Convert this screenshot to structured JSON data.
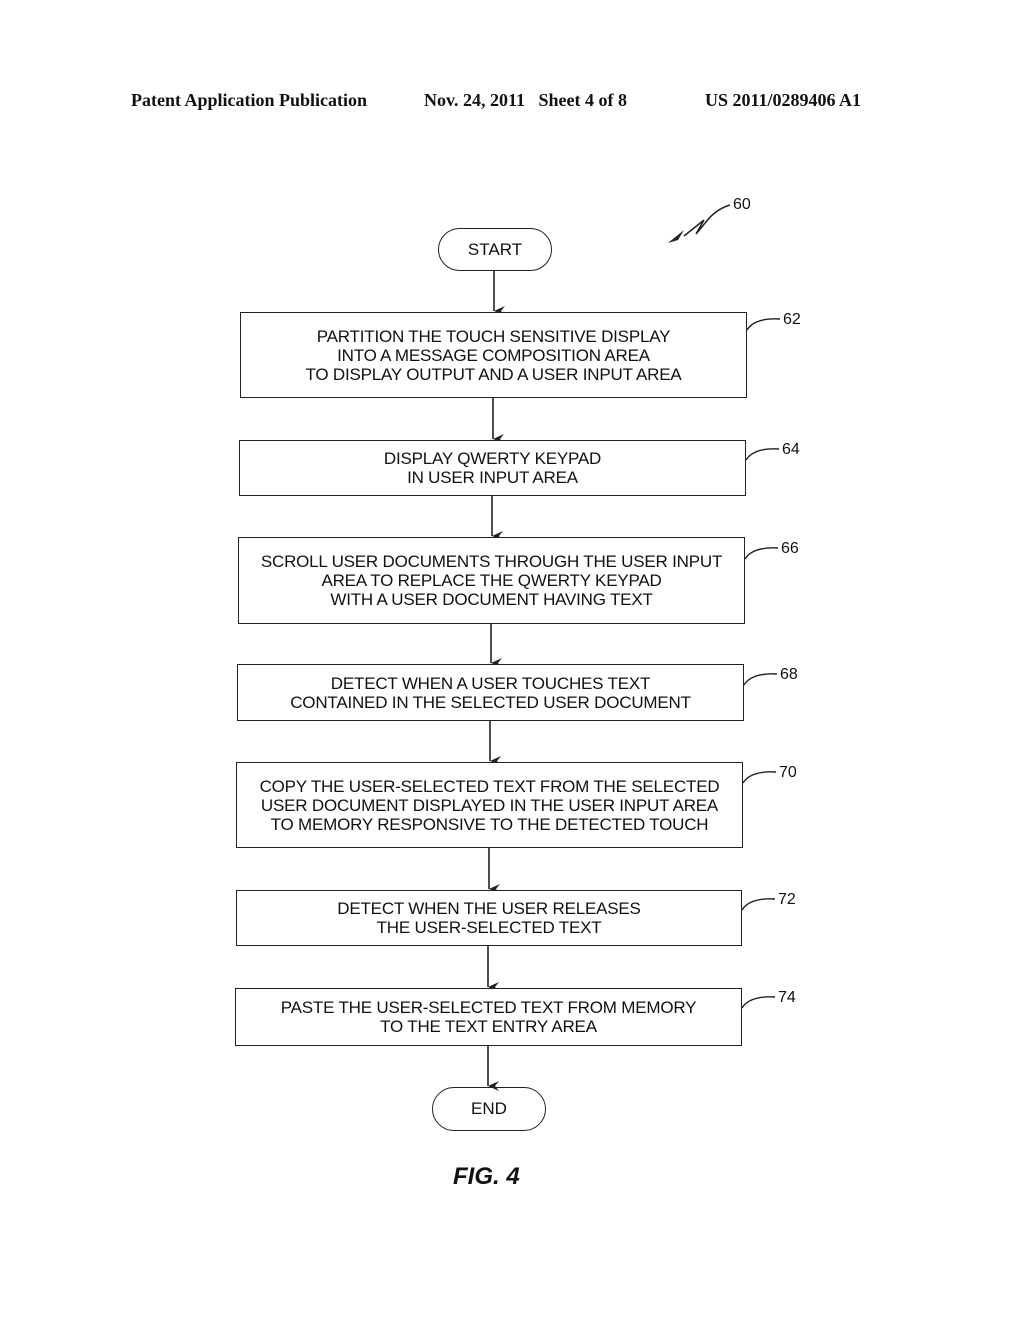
{
  "header": {
    "publication": "Patent Application Publication",
    "date_sheet": "Nov. 24, 2011   Sheet 4 of 8",
    "number": "US 2011/0289406 A1"
  },
  "diagram": {
    "ref_main": "60",
    "start_label": "START",
    "end_label": "END",
    "steps": [
      {
        "ref": "62",
        "lines": [
          "PARTITION THE TOUCH SENSITIVE DISPLAY",
          "INTO A MESSAGE COMPOSITION AREA",
          "TO DISPLAY OUTPUT AND A USER INPUT AREA"
        ]
      },
      {
        "ref": "64",
        "lines": [
          "DISPLAY QWERTY KEYPAD",
          "IN USER INPUT AREA"
        ]
      },
      {
        "ref": "66",
        "lines": [
          "SCROLL USER DOCUMENTS THROUGH THE USER INPUT",
          "AREA TO REPLACE THE QWERTY KEYPAD",
          "WITH A USER DOCUMENT HAVING TEXT"
        ]
      },
      {
        "ref": "68",
        "lines": [
          "DETECT WHEN A USER TOUCHES TEXT",
          "CONTAINED IN THE SELECTED USER DOCUMENT"
        ]
      },
      {
        "ref": "70",
        "lines": [
          "COPY THE USER-SELECTED TEXT FROM THE SELECTED",
          "USER DOCUMENT DISPLAYED IN THE USER INPUT AREA",
          "TO MEMORY RESPONSIVE TO THE DETECTED TOUCH"
        ]
      },
      {
        "ref": "72",
        "lines": [
          "DETECT WHEN THE USER RELEASES",
          "THE USER-SELECTED TEXT"
        ]
      },
      {
        "ref": "74",
        "lines": [
          "PASTE THE USER-SELECTED TEXT FROM MEMORY",
          "TO THE TEXT ENTRY AREA"
        ]
      }
    ],
    "figure_label": "FIG. 4"
  }
}
